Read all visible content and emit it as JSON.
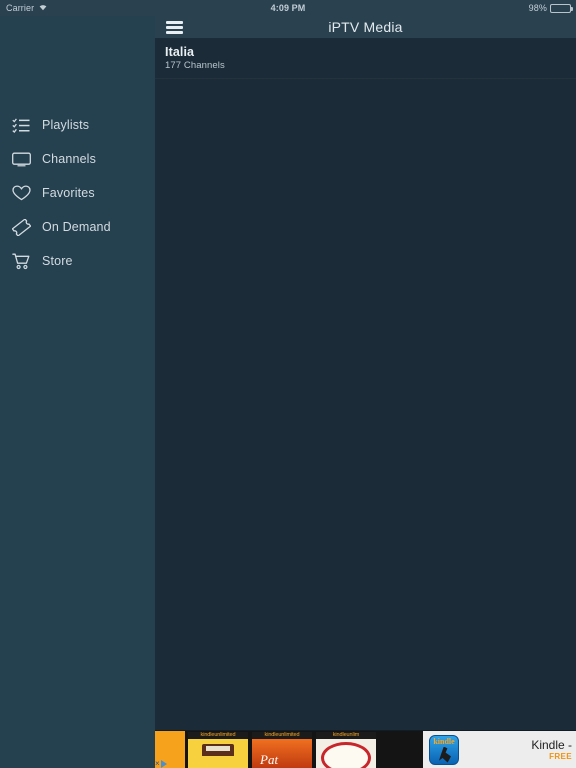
{
  "status_bar": {
    "carrier": "Carrier",
    "wifi_icon": "wifi-icon",
    "time": "4:09 PM",
    "battery_percent": "98%",
    "battery_icon": "battery-icon",
    "battery_color": "#4cd964"
  },
  "sidebar": {
    "background": "#25404f",
    "items": [
      {
        "label": "Playlists",
        "icon": "playlist-icon"
      },
      {
        "label": "Channels",
        "icon": "tv-monitor-icon"
      },
      {
        "label": "Favorites",
        "icon": "heart-icon"
      },
      {
        "label": "On Demand",
        "icon": "ticket-icon"
      },
      {
        "label": "Store",
        "icon": "shopping-cart-icon"
      }
    ]
  },
  "navbar": {
    "menu_icon": "hamburger-menu-icon",
    "title": "iPTV Media",
    "background": "#2a4150"
  },
  "main": {
    "background": "#1b2b38",
    "rows": [
      {
        "title": "Italia",
        "subtitle": "177 Channels"
      }
    ]
  },
  "ad_banner": {
    "adchoices_label": "AdChoices",
    "adchoices_x": "×",
    "books": [
      {
        "ku_label": "kindleunlimited",
        "cover": "typewriter-cover"
      },
      {
        "ku_label": "kindleunlimited",
        "cover": "pat-sunset-cover",
        "title": "Pat"
      },
      {
        "ku_label": "kindleunlim",
        "cover": "plate-cover"
      }
    ],
    "app_icon": "kindle-app-icon",
    "app_icon_text": "kindle",
    "app_title": "Kindle -",
    "price": "FREE"
  }
}
